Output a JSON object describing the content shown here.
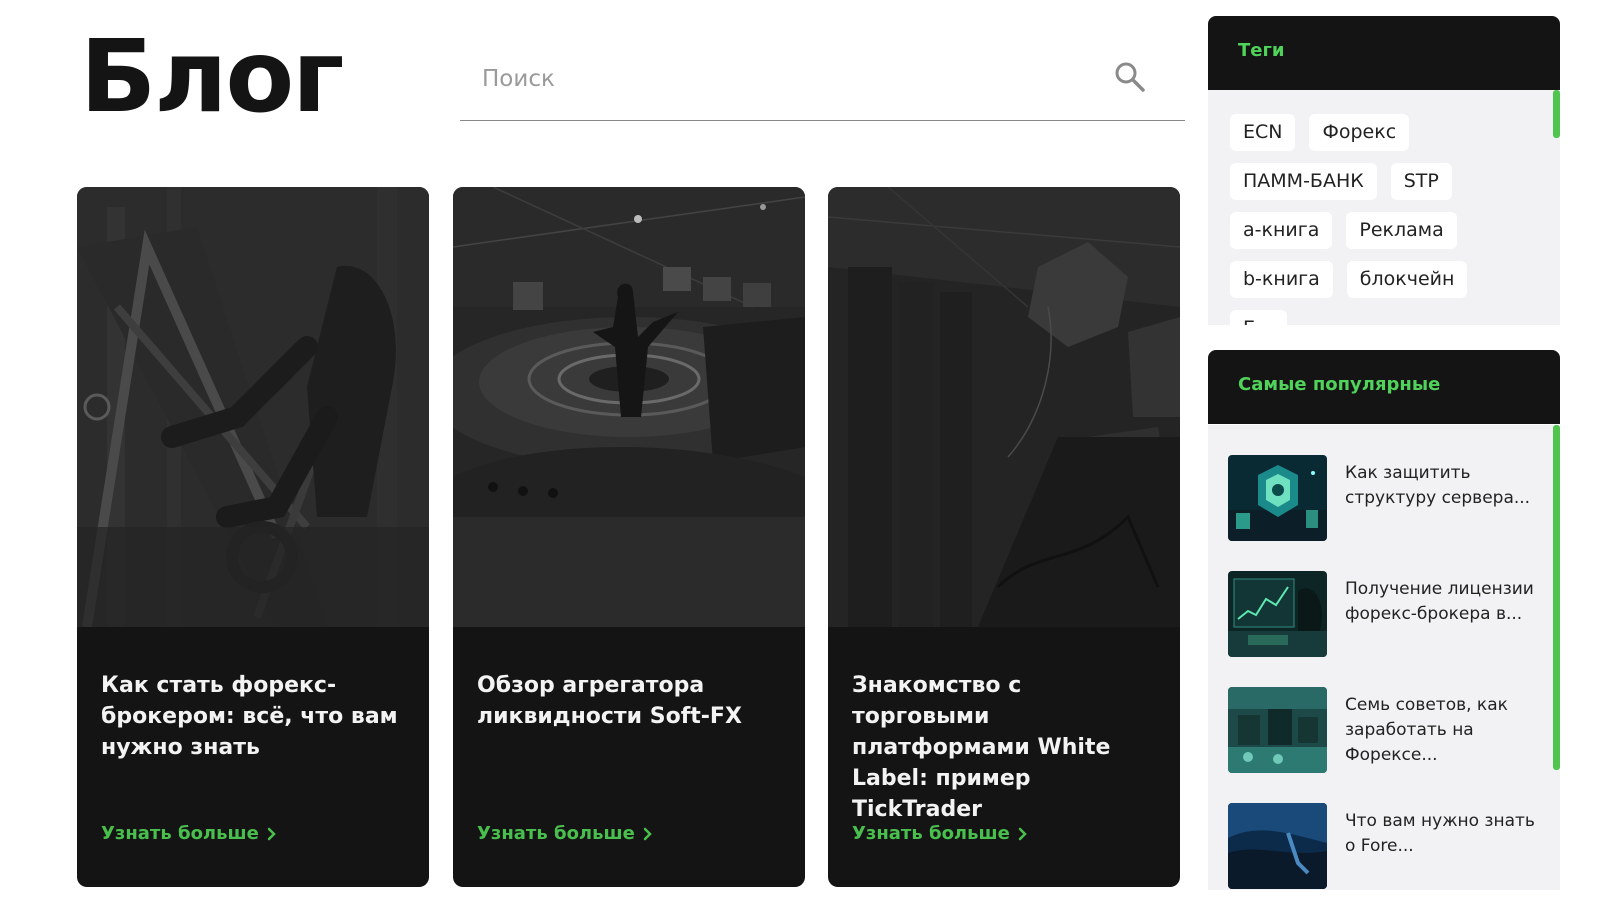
{
  "page": {
    "title": "Блог"
  },
  "search": {
    "placeholder": "Поиск"
  },
  "cards": [
    {
      "title": "Как стать форекс-брокером: всё, что вам нужно знать",
      "link": "Узнать больше"
    },
    {
      "title": "Обзор агрегатора ликвидности Soft-FX",
      "link": "Узнать больше"
    },
    {
      "title": "Знакомство с торговыми платформами White Label: пример TickTrader",
      "link": "Узнать больше"
    }
  ],
  "sidebar": {
    "tags": {
      "heading": "Теги",
      "items": [
        "ECN",
        "Форекс",
        "ПАММ-БАНК",
        "STP",
        "а-книга",
        "Реклама",
        "b-книга",
        "блокчейн",
        "Б..."
      ]
    },
    "popular": {
      "heading": "Самые популярные",
      "items": [
        "Как защитить структуру сервера...",
        "Получение лицензии форекс-брокера в...",
        "Семь советов, как заработать на Форексе...",
        "Что вам нужно знать о Fore..."
      ]
    }
  },
  "colors": {
    "accent": "#49c04d",
    "dark": "#141414",
    "panel": "#f2f2f4"
  },
  "icons": {
    "search": "search-icon",
    "chevron": "chevron-right-icon"
  }
}
